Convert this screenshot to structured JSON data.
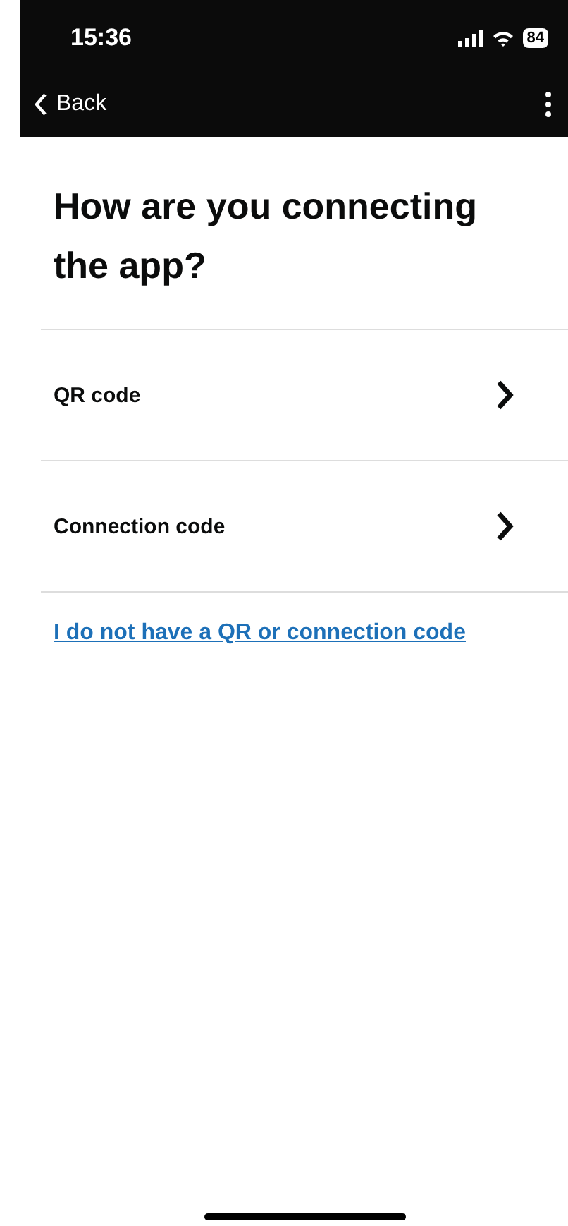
{
  "status_bar": {
    "time": "15:36",
    "battery": "84"
  },
  "nav": {
    "back": "Back"
  },
  "title": "How are you connecting the app?",
  "options": [
    {
      "label": "QR code"
    },
    {
      "label": "Connection code"
    }
  ],
  "link": "I do not have a QR or connection code"
}
